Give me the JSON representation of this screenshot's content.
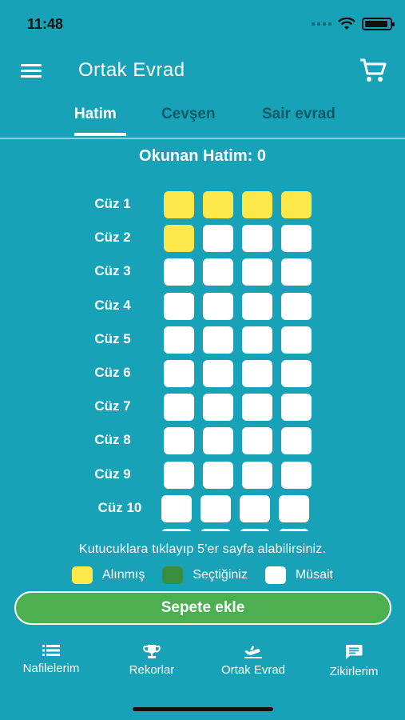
{
  "status": {
    "time": "11:48"
  },
  "appbar": {
    "title": "Ortak Evrad"
  },
  "tabs": [
    {
      "label": "Hatim",
      "active": true
    },
    {
      "label": "Cevşen",
      "active": false
    },
    {
      "label": "Sair evrad",
      "active": false
    }
  ],
  "counter": {
    "label": "Okunan Hatim: 0"
  },
  "juz_rows": [
    {
      "label": "Cüz 1",
      "boxes": [
        "taken",
        "taken",
        "taken",
        "taken"
      ]
    },
    {
      "label": "Cüz 2",
      "boxes": [
        "taken",
        "available",
        "available",
        "available"
      ]
    },
    {
      "label": "Cüz 3",
      "boxes": [
        "available",
        "available",
        "available",
        "available"
      ]
    },
    {
      "label": "Cüz 4",
      "boxes": [
        "available",
        "available",
        "available",
        "available"
      ]
    },
    {
      "label": "Cüz 5",
      "boxes": [
        "available",
        "available",
        "available",
        "available"
      ]
    },
    {
      "label": "Cüz 6",
      "boxes": [
        "available",
        "available",
        "available",
        "available"
      ]
    },
    {
      "label": "Cüz 7",
      "boxes": [
        "available",
        "available",
        "available",
        "available"
      ]
    },
    {
      "label": "Cüz 8",
      "boxes": [
        "available",
        "available",
        "available",
        "available"
      ]
    },
    {
      "label": "Cüz 9",
      "boxes": [
        "available",
        "available",
        "available",
        "available"
      ]
    },
    {
      "label": "Cüz 10",
      "boxes": [
        "available",
        "available",
        "available",
        "available"
      ]
    },
    {
      "label": "",
      "boxes": [
        "available",
        "available",
        "available",
        "available"
      ]
    }
  ],
  "hint": "Kutucuklara tıklayıp 5'er sayfa alabilirsiniz.",
  "legend": [
    {
      "label": "Alınmış",
      "color": "#fde84a"
    },
    {
      "label": "Seçtiğiniz",
      "color": "#3a8f3e"
    },
    {
      "label": "Müsait",
      "color": "#ffffff"
    }
  ],
  "cart_button": {
    "label": "Sepete ekle"
  },
  "bottom_nav": [
    {
      "label": "Nafilelerim",
      "icon": "list-icon"
    },
    {
      "label": "Rekorlar",
      "icon": "trophy-icon"
    },
    {
      "label": "Ortak Evrad",
      "icon": "plane-icon"
    },
    {
      "label": "Zikirlerim",
      "icon": "chat-icon"
    }
  ],
  "colors": {
    "background": "#18a2b8",
    "taken": "#fde84a",
    "selected": "#3a8f3e",
    "available": "#ffffff",
    "button": "#4caf50"
  }
}
